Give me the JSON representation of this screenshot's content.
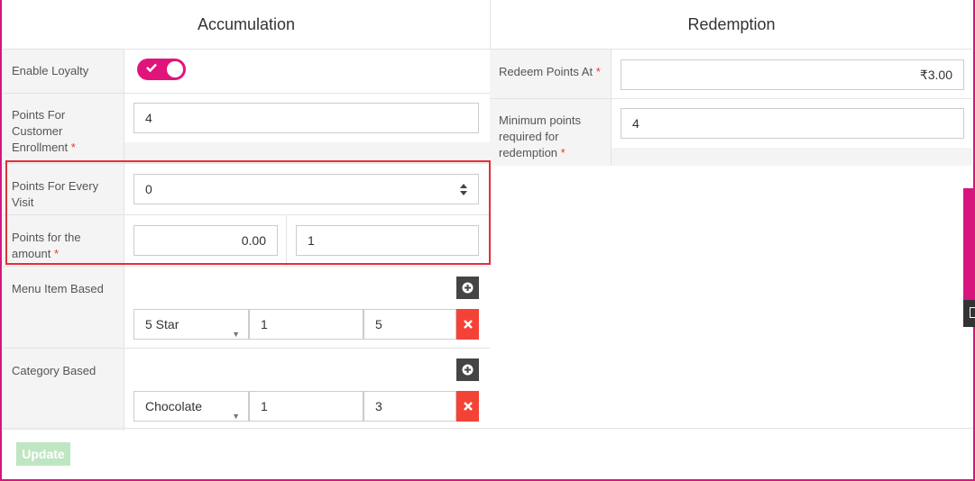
{
  "accumulation": {
    "header": "Accumulation",
    "enable_loyalty": {
      "label": "Enable Loyalty",
      "enabled": true
    },
    "enrollment": {
      "label": "Points For Customer Enrollment",
      "label_lines": [
        "Points For",
        "Customer",
        "Enrollment"
      ],
      "required": "*",
      "value": "4"
    },
    "every_visit": {
      "label_lines": [
        "Points For Every",
        "Visit"
      ],
      "value": "0"
    },
    "amount": {
      "label_lines": [
        "Points for the",
        "amount"
      ],
      "required": "*",
      "amount_value": "0.00",
      "points_value": "1"
    },
    "menu_item": {
      "label": "Menu Item Based",
      "select": "5 Star",
      "value1": "1",
      "value2": "5"
    },
    "category": {
      "label": "Category Based",
      "select": "Chocolate",
      "value1": "1",
      "value2": "3"
    }
  },
  "redemption": {
    "header": "Redemption",
    "redeem_at": {
      "label": "Redeem Points At",
      "required": "*",
      "value": "₹3.00"
    },
    "minimum": {
      "label_lines": [
        "Minimum points",
        "required for",
        "redemption"
      ],
      "required": "*",
      "value": "4"
    }
  },
  "update_label": "Update",
  "colors": {
    "brand": "#e0157b",
    "danger": "#f44336",
    "highlight": "#e02f3a",
    "update_disabled": "#bfe6c2"
  }
}
